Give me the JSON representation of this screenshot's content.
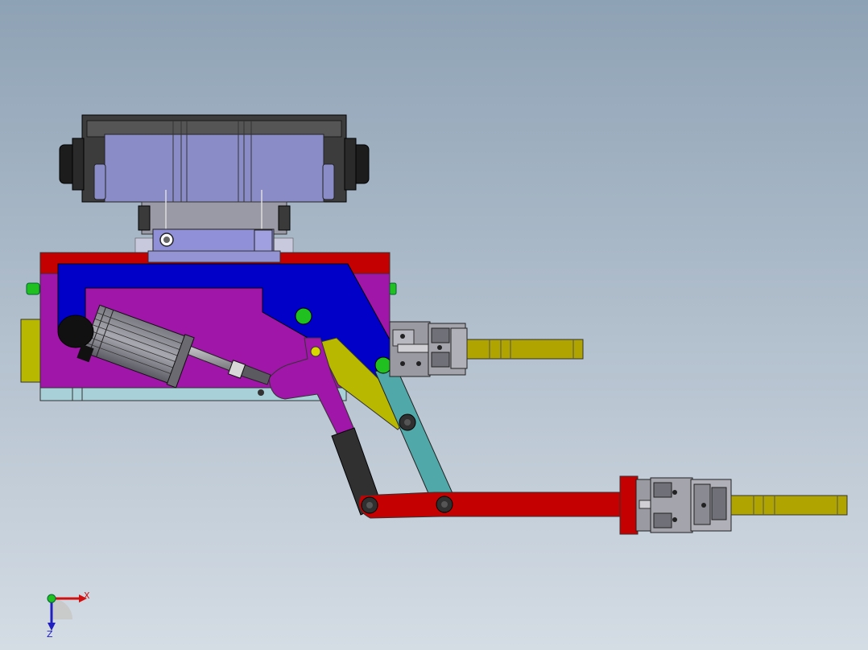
{
  "axes": {
    "x_label": "X",
    "z_label": "Z"
  },
  "colors": {
    "background_top": "#8fa3b6",
    "background_bottom": "#ccd5df",
    "frame_red": "#c40000",
    "base_magenta": "#a016a8",
    "blue_arm": "#0000c8",
    "motor_mount_lavender": "#8c8cd0",
    "base_plate_lightblue": "#a8d0d8",
    "yellow_olive": "#b8b800",
    "teal_link": "#50a8a8",
    "dark_link": "#303030",
    "pivot_green": "#20c020",
    "gripper_gray": "#909098"
  }
}
